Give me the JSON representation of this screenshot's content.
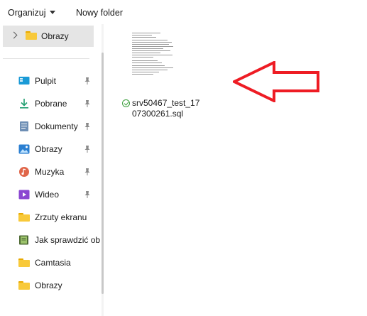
{
  "toolbar": {
    "organize_label": "Organizuj",
    "new_folder_label": "Nowy folder"
  },
  "nav": {
    "top_item": {
      "label": "Obrazy",
      "icon": "folder-icon"
    },
    "quick_access": [
      {
        "label": "Pulpit",
        "icon": "desktop-icon",
        "pinned": true
      },
      {
        "label": "Pobrane",
        "icon": "download-icon",
        "pinned": true
      },
      {
        "label": "Dokumenty",
        "icon": "documents-icon",
        "pinned": true
      },
      {
        "label": "Obrazy",
        "icon": "pictures-icon",
        "pinned": true
      },
      {
        "label": "Muzyka",
        "icon": "music-icon",
        "pinned": true
      },
      {
        "label": "Wideo",
        "icon": "video-icon",
        "pinned": true
      },
      {
        "label": "Zrzuty ekranu",
        "icon": "folder-icon",
        "pinned": false
      },
      {
        "label": "Jak sprawdzić ob",
        "icon": "book-icon",
        "pinned": true
      },
      {
        "label": "Camtasia",
        "icon": "folder-icon",
        "pinned": false
      },
      {
        "label": "Obrazy",
        "icon": "folder-icon",
        "pinned": false
      }
    ]
  },
  "content": {
    "file": {
      "name": "srv50467_test_1707300261.sql",
      "status_icon": "synced-check-icon"
    }
  },
  "colors": {
    "annotation_arrow": "#ee1c24",
    "folder": "#f8c93a",
    "sync_ok": "#3a9e3a",
    "selected_bg": "#e5e5e5"
  }
}
